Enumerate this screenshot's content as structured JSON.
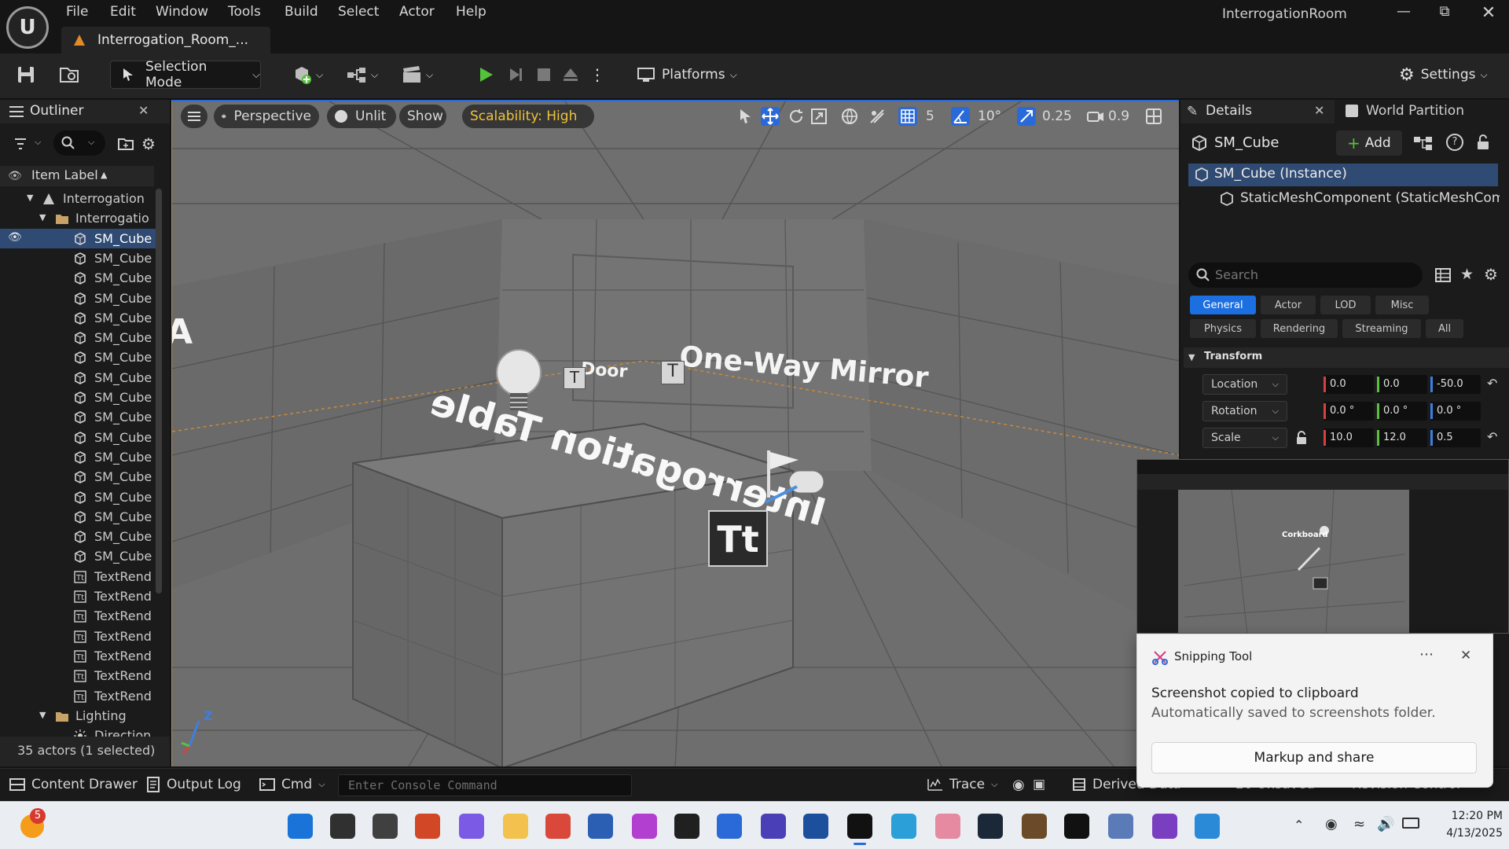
{
  "app": {
    "window_title": "InterrogationRoom",
    "menu": [
      "File",
      "Edit",
      "Window",
      "Tools",
      "Build",
      "Select",
      "Actor",
      "Help"
    ],
    "tab": "Interrogation_Room_..."
  },
  "toolbar": {
    "selection_mode": "Selection Mode",
    "platforms": "Platforms",
    "settings": "Settings"
  },
  "outliner": {
    "title": "Outliner",
    "column_label": "Item Label",
    "rows": [
      {
        "label": "Interrogation",
        "indent": 1,
        "kind": "level"
      },
      {
        "label": "Interrogatio",
        "indent": 2,
        "kind": "folder"
      },
      {
        "label": "SM_Cube",
        "indent": 3,
        "kind": "mesh",
        "selected": true
      },
      {
        "label": "SM_Cube",
        "indent": 3,
        "kind": "mesh"
      },
      {
        "label": "SM_Cube",
        "indent": 3,
        "kind": "mesh"
      },
      {
        "label": "SM_Cube",
        "indent": 3,
        "kind": "mesh"
      },
      {
        "label": "SM_Cube",
        "indent": 3,
        "kind": "mesh"
      },
      {
        "label": "SM_Cube",
        "indent": 3,
        "kind": "mesh"
      },
      {
        "label": "SM_Cube",
        "indent": 3,
        "kind": "mesh"
      },
      {
        "label": "SM_Cube",
        "indent": 3,
        "kind": "mesh"
      },
      {
        "label": "SM_Cube",
        "indent": 3,
        "kind": "mesh"
      },
      {
        "label": "SM_Cube",
        "indent": 3,
        "kind": "mesh"
      },
      {
        "label": "SM_Cube",
        "indent": 3,
        "kind": "mesh"
      },
      {
        "label": "SM_Cube",
        "indent": 3,
        "kind": "mesh"
      },
      {
        "label": "SM_Cube",
        "indent": 3,
        "kind": "mesh"
      },
      {
        "label": "SM_Cube",
        "indent": 3,
        "kind": "mesh"
      },
      {
        "label": "SM_Cube",
        "indent": 3,
        "kind": "mesh"
      },
      {
        "label": "SM_Cube",
        "indent": 3,
        "kind": "mesh"
      },
      {
        "label": "SM_Cube",
        "indent": 3,
        "kind": "mesh"
      },
      {
        "label": "TextRend",
        "indent": 3,
        "kind": "text"
      },
      {
        "label": "TextRend",
        "indent": 3,
        "kind": "text"
      },
      {
        "label": "TextRend",
        "indent": 3,
        "kind": "text"
      },
      {
        "label": "TextRend",
        "indent": 3,
        "kind": "text"
      },
      {
        "label": "TextRend",
        "indent": 3,
        "kind": "text"
      },
      {
        "label": "TextRend",
        "indent": 3,
        "kind": "text"
      },
      {
        "label": "TextRend",
        "indent": 3,
        "kind": "text"
      },
      {
        "label": "Lighting",
        "indent": 2,
        "kind": "folder"
      },
      {
        "label": "Direction",
        "indent": 3,
        "kind": "light"
      }
    ],
    "footer": "35 actors (1 selected)"
  },
  "viewport": {
    "perspective": "Perspective",
    "unlit": "Unlit",
    "show": "Show",
    "scalability": "Scalability: High",
    "grid_snap": "5",
    "rot_snap": "10°",
    "scale_snap": "0.25",
    "camera_speed": "0.9",
    "scene_text": {
      "door": "Door",
      "mirror": "One-Way Mirror",
      "table": "Interrogation Table",
      "partial": "A"
    },
    "axis_label": "Z"
  },
  "details": {
    "tab_details": "Details",
    "tab_world_partition": "World Partition",
    "actor_name": "SM_Cube",
    "add_label": "Add",
    "components": [
      "SM_Cube (Instance)",
      "StaticMeshComponent (StaticMeshCompo"
    ],
    "search_placeholder": "Search",
    "filters_row1": [
      "General",
      "Actor",
      "LOD",
      "Misc"
    ],
    "filters_row2": [
      "Physics",
      "Rendering",
      "Streaming",
      "All"
    ],
    "section": "Transform",
    "location_label": "Location",
    "rotation_label": "Rotation",
    "scale_label": "Scale",
    "location": [
      "0.0",
      "0.0",
      "-50.0"
    ],
    "rotation": [
      "0.0 °",
      "0.0 °",
      "0.0 °"
    ],
    "scale": [
      "10.0",
      "12.0",
      "0.5"
    ]
  },
  "statusbar": {
    "content_drawer": "Content Drawer",
    "output_log": "Output Log",
    "cmd": "Cmd",
    "console_placeholder": "Enter Console Command",
    "trace": "Trace",
    "derived_data": "Derived Data",
    "unsaved": "20 Unsaved",
    "revision_control": "Revision Control"
  },
  "snipping": {
    "app_name": "Snipping Tool",
    "title": "Screenshot copied to clipboard",
    "subtitle": "Automatically saved to screenshots folder.",
    "action": "Markup and share",
    "thumb_text": "Corkboard"
  },
  "taskbar": {
    "badge": "5",
    "time": "12:20 PM",
    "date": "4/13/2025"
  },
  "colors": {
    "accent_blue": "#2a6ad8",
    "selection": "#2f4a73",
    "scalability": "#f0c23a",
    "play_green": "#55c23b",
    "x_axis": "#d84040",
    "y_axis": "#5bbf3f",
    "z_axis": "#3d7fe0"
  }
}
